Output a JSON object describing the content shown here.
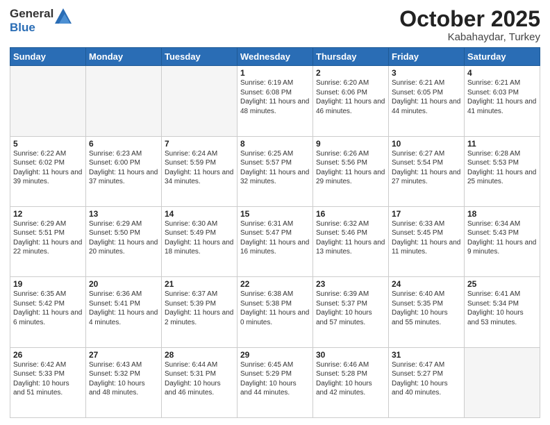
{
  "header": {
    "logo_general": "General",
    "logo_blue": "Blue",
    "month_title": "October 2025",
    "location": "Kabahaydar, Turkey"
  },
  "days_of_week": [
    "Sunday",
    "Monday",
    "Tuesday",
    "Wednesday",
    "Thursday",
    "Friday",
    "Saturday"
  ],
  "weeks": [
    [
      {
        "day": "",
        "info": ""
      },
      {
        "day": "",
        "info": ""
      },
      {
        "day": "",
        "info": ""
      },
      {
        "day": "1",
        "info": "Sunrise: 6:19 AM\nSunset: 6:08 PM\nDaylight: 11 hours and 48 minutes."
      },
      {
        "day": "2",
        "info": "Sunrise: 6:20 AM\nSunset: 6:06 PM\nDaylight: 11 hours and 46 minutes."
      },
      {
        "day": "3",
        "info": "Sunrise: 6:21 AM\nSunset: 6:05 PM\nDaylight: 11 hours and 44 minutes."
      },
      {
        "day": "4",
        "info": "Sunrise: 6:21 AM\nSunset: 6:03 PM\nDaylight: 11 hours and 41 minutes."
      }
    ],
    [
      {
        "day": "5",
        "info": "Sunrise: 6:22 AM\nSunset: 6:02 PM\nDaylight: 11 hours and 39 minutes."
      },
      {
        "day": "6",
        "info": "Sunrise: 6:23 AM\nSunset: 6:00 PM\nDaylight: 11 hours and 37 minutes."
      },
      {
        "day": "7",
        "info": "Sunrise: 6:24 AM\nSunset: 5:59 PM\nDaylight: 11 hours and 34 minutes."
      },
      {
        "day": "8",
        "info": "Sunrise: 6:25 AM\nSunset: 5:57 PM\nDaylight: 11 hours and 32 minutes."
      },
      {
        "day": "9",
        "info": "Sunrise: 6:26 AM\nSunset: 5:56 PM\nDaylight: 11 hours and 29 minutes."
      },
      {
        "day": "10",
        "info": "Sunrise: 6:27 AM\nSunset: 5:54 PM\nDaylight: 11 hours and 27 minutes."
      },
      {
        "day": "11",
        "info": "Sunrise: 6:28 AM\nSunset: 5:53 PM\nDaylight: 11 hours and 25 minutes."
      }
    ],
    [
      {
        "day": "12",
        "info": "Sunrise: 6:29 AM\nSunset: 5:51 PM\nDaylight: 11 hours and 22 minutes."
      },
      {
        "day": "13",
        "info": "Sunrise: 6:29 AM\nSunset: 5:50 PM\nDaylight: 11 hours and 20 minutes."
      },
      {
        "day": "14",
        "info": "Sunrise: 6:30 AM\nSunset: 5:49 PM\nDaylight: 11 hours and 18 minutes."
      },
      {
        "day": "15",
        "info": "Sunrise: 6:31 AM\nSunset: 5:47 PM\nDaylight: 11 hours and 16 minutes."
      },
      {
        "day": "16",
        "info": "Sunrise: 6:32 AM\nSunset: 5:46 PM\nDaylight: 11 hours and 13 minutes."
      },
      {
        "day": "17",
        "info": "Sunrise: 6:33 AM\nSunset: 5:45 PM\nDaylight: 11 hours and 11 minutes."
      },
      {
        "day": "18",
        "info": "Sunrise: 6:34 AM\nSunset: 5:43 PM\nDaylight: 11 hours and 9 minutes."
      }
    ],
    [
      {
        "day": "19",
        "info": "Sunrise: 6:35 AM\nSunset: 5:42 PM\nDaylight: 11 hours and 6 minutes."
      },
      {
        "day": "20",
        "info": "Sunrise: 6:36 AM\nSunset: 5:41 PM\nDaylight: 11 hours and 4 minutes."
      },
      {
        "day": "21",
        "info": "Sunrise: 6:37 AM\nSunset: 5:39 PM\nDaylight: 11 hours and 2 minutes."
      },
      {
        "day": "22",
        "info": "Sunrise: 6:38 AM\nSunset: 5:38 PM\nDaylight: 11 hours and 0 minutes."
      },
      {
        "day": "23",
        "info": "Sunrise: 6:39 AM\nSunset: 5:37 PM\nDaylight: 10 hours and 57 minutes."
      },
      {
        "day": "24",
        "info": "Sunrise: 6:40 AM\nSunset: 5:35 PM\nDaylight: 10 hours and 55 minutes."
      },
      {
        "day": "25",
        "info": "Sunrise: 6:41 AM\nSunset: 5:34 PM\nDaylight: 10 hours and 53 minutes."
      }
    ],
    [
      {
        "day": "26",
        "info": "Sunrise: 6:42 AM\nSunset: 5:33 PM\nDaylight: 10 hours and 51 minutes."
      },
      {
        "day": "27",
        "info": "Sunrise: 6:43 AM\nSunset: 5:32 PM\nDaylight: 10 hours and 48 minutes."
      },
      {
        "day": "28",
        "info": "Sunrise: 6:44 AM\nSunset: 5:31 PM\nDaylight: 10 hours and 46 minutes."
      },
      {
        "day": "29",
        "info": "Sunrise: 6:45 AM\nSunset: 5:29 PM\nDaylight: 10 hours and 44 minutes."
      },
      {
        "day": "30",
        "info": "Sunrise: 6:46 AM\nSunset: 5:28 PM\nDaylight: 10 hours and 42 minutes."
      },
      {
        "day": "31",
        "info": "Sunrise: 6:47 AM\nSunset: 5:27 PM\nDaylight: 10 hours and 40 minutes."
      },
      {
        "day": "",
        "info": ""
      }
    ]
  ]
}
